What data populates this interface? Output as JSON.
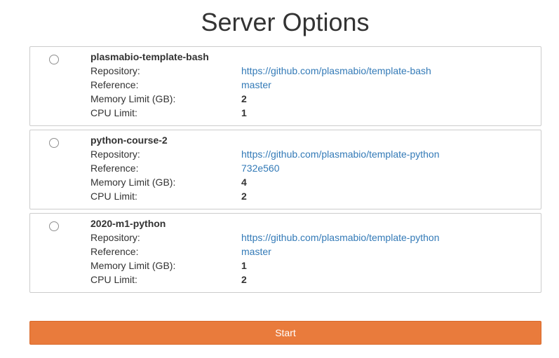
{
  "page": {
    "title": "Server Options"
  },
  "labels": {
    "repository": "Repository:",
    "reference": "Reference:",
    "memory": "Memory Limit (GB):",
    "cpu": "CPU Limit:"
  },
  "options": [
    {
      "name": "plasmabio-template-bash",
      "repository": "https://github.com/plasmabio/template-bash",
      "reference": "master",
      "memory": "2",
      "cpu": "1",
      "selected": false
    },
    {
      "name": "python-course-2",
      "repository": "https://github.com/plasmabio/template-python",
      "reference": "732e560",
      "memory": "4",
      "cpu": "2",
      "selected": false
    },
    {
      "name": "2020-m1-python",
      "repository": "https://github.com/plasmabio/template-python",
      "reference": "master",
      "memory": "1",
      "cpu": "2",
      "selected": false
    }
  ],
  "start_button": {
    "label": "Start"
  },
  "colors": {
    "accent": "#e97b3c",
    "link": "#337ab7",
    "border": "#cccccc",
    "text": "#333333"
  }
}
